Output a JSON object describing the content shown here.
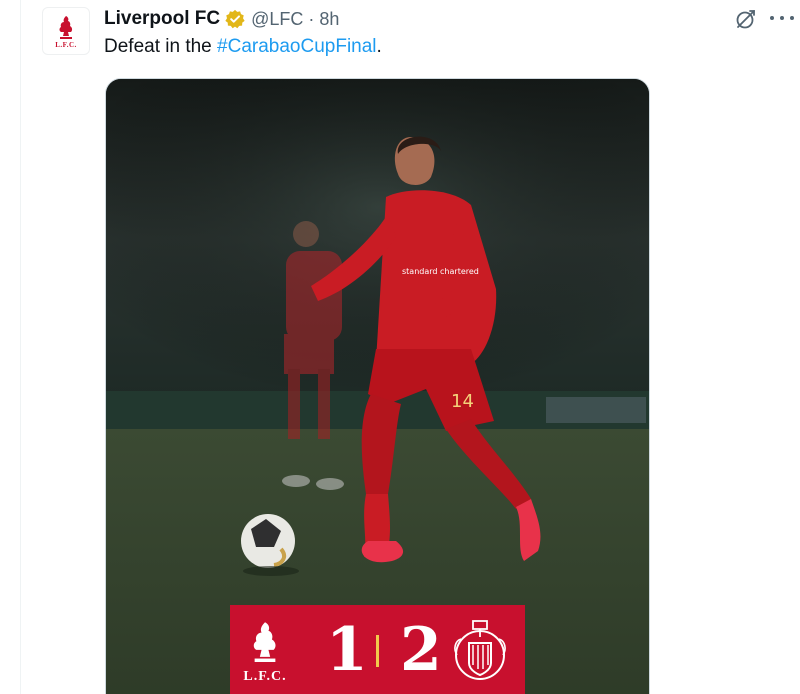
{
  "tweet": {
    "display_name": "Liverpool FC",
    "handle": "@LFC",
    "separator": "·",
    "time": "8h",
    "text_prefix": "Defeat in the ",
    "hashtag": "#CarabaoCupFinal",
    "text_suffix": ".",
    "avatar_text": "L.F.C."
  },
  "media": {
    "shirt_number": "14",
    "sponsor": "standard chartered",
    "scoreboard": {
      "home_crest_text": "L.F.C.",
      "home_score": "1",
      "away_score": "2"
    }
  },
  "colors": {
    "liverpool_red": "#c8102e",
    "link_blue": "#1d9bf0",
    "verified_gold": "#e2b719",
    "secondary_text": "#536471"
  },
  "icons": [
    "liverbird-icon",
    "verified-badge-icon",
    "grok-icon",
    "more-options-icon",
    "newcastle-crest-icon"
  ]
}
